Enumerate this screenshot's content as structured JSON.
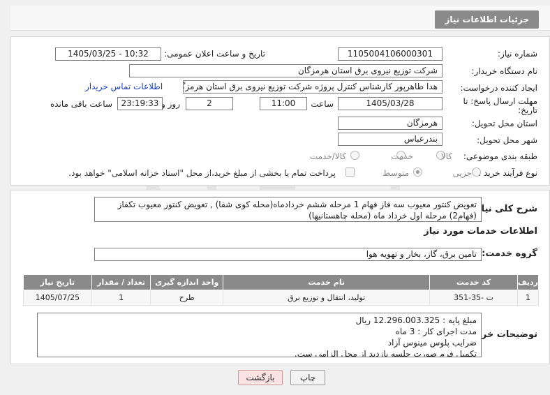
{
  "header": {
    "title": "جزئیات اطلاعات نیاز"
  },
  "fields": {
    "need_number_label": "شماره نیاز:",
    "need_number": "1105004106000301",
    "announce_label": "تاریخ و ساعت اعلان عمومی:",
    "announce_value": "1405/03/25 - 10:32",
    "buyer_org_label": "نام دستگاه خریدار:",
    "buyer_org": "شرکت توزیع نیروی برق استان هرمزگان",
    "creator_label": "ایجاد کننده درخواست:",
    "creator": "هدا طاهرپور کارشناس کنترل پروژه شرکت توزیع نیروی برق استان هرمزگان",
    "contact_link": "اطلاعات تماس خریدار",
    "deadline_label_1": "مهلت ارسال پاسخ: تا",
    "deadline_label_2": "تاریخ:",
    "deadline_date": "1405/03/28",
    "hour_label": "ساعت",
    "deadline_time": "11:00",
    "days_value": "2",
    "days_label": "روز و",
    "remaining_value": "23:19:33",
    "remaining_label": "ساعت باقی مانده",
    "province_label": "استان محل تحویل:",
    "province": "هرمزگان",
    "city_label": "شهر محل تحویل:",
    "city": "بندرعباس",
    "category_label": "طبقه بندی موضوعی:",
    "category_opts": [
      "کالا",
      "خدمت",
      "کالا/خدمت"
    ],
    "process_label": "نوع فرآیند خرید :",
    "process_opts": [
      "جزیی",
      "متوسط"
    ],
    "payment_note": "پرداخت تمام یا بخشی از مبلغ خرید،از محل \"اسناد خزانه اسلامی\" خواهد بود."
  },
  "summary": {
    "label": "شرح کلی نیاز:",
    "text": "تعویض کنتور معیوب سه فاز فهام 1 مرحله ششم خردادماه(محله کوی شفا) , تعویض کنتور معیوب تکفاز (فهام2) مرحله اول خرداد ماه (محله چاهستانیها)"
  },
  "services": {
    "section_title": "اطلاعات خدمات مورد نیاز",
    "group_label": "گروه خدمت:",
    "group_value": "تامین برق، گاز، بخار و تهویه هوا",
    "columns": [
      "ردیف",
      "کد خدمت",
      "نام خدمت",
      "واحد اندازه گیری",
      "تعداد / مقدار",
      "تاریخ نیاز"
    ],
    "rows": [
      [
        "1",
        "ت -35-351",
        "تولید، انتقال و توزیع برق",
        "طرح",
        "1",
        "1405/07/25"
      ]
    ]
  },
  "buyer_notes": {
    "label": "توضیحات خریدار:",
    "lines": [
      "مبلغ پایه : 12.296.003.325 ریال",
      "مدت اجرای کار : 3 ماه",
      "ضرایب پلوس مینوس آزاد",
      "تکمیل فرم صورت جلسه بازدید از محل الزامی ست."
    ]
  },
  "buttons": {
    "print": "چاپ",
    "back": "بازگشت"
  },
  "watermark": "AriaTender.neT"
}
